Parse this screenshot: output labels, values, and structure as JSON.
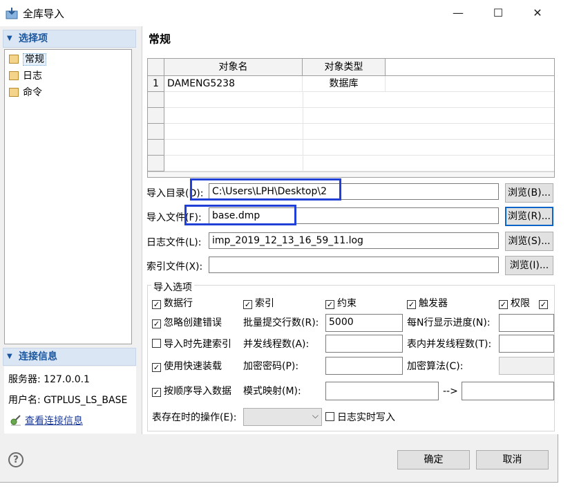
{
  "window": {
    "title": "全库导入",
    "minimize_glyph": "—",
    "maximize_glyph": "☐",
    "close_glyph": "✕"
  },
  "left": {
    "options_header": "选择项",
    "tree_items": [
      "常规",
      "日志",
      "命令"
    ],
    "connection_header": "连接信息",
    "server": "服务器: 127.0.0.1",
    "user": "用户名: GTPLUS_LS_BASE",
    "view_link": "查看连接信息"
  },
  "main": {
    "section_title": "常规",
    "grid": {
      "columns": [
        "对象名",
        "对象类型"
      ],
      "rows": [
        {
          "num": "1",
          "name": "DAMENG5238",
          "type": "数据库"
        }
      ]
    },
    "import_dir": {
      "label": "导入目录(D):",
      "value": "C:\\Users\\LPH\\Desktop\\2",
      "browse": "浏览(B)..."
    },
    "import_file": {
      "label": "导入文件(F):",
      "value": "base.dmp",
      "browse": "浏览(R)..."
    },
    "log_file": {
      "label": "日志文件(L):",
      "value": "imp_2019_12_13_16_59_11.log",
      "browse": "浏览(S)..."
    },
    "index_file": {
      "label": "索引文件(X):",
      "value": "",
      "browse": "浏览(I)..."
    },
    "options": {
      "title": "导入选项",
      "rows": "数据行",
      "index": "索引",
      "constraint": "约束",
      "trigger": "触发器",
      "privilege": "权限",
      "ignore_errors": "忽略创建错误",
      "batch_rows_label": "批量提交行数(R):",
      "batch_rows_value": "5000",
      "progress_label": "每N行显示进度(N):",
      "create_index_first": "导入时先建索引",
      "threads_label": "并发线程数(A):",
      "table_threads_label": "表内并发线程数(T):",
      "fast_load": "使用快速装载",
      "encrypt_pwd_label": "加密密码(P):",
      "encrypt_algo_label": "加密算法(C):",
      "ordered_import": "按顺序导入数据",
      "schema_map_label": "模式映射(M):",
      "schema_arrow": "-->",
      "table_exists_label": "表存在时的操作(E):",
      "log_realtime": "日志实时写入"
    }
  },
  "footer": {
    "ok": "确定",
    "cancel": "取消",
    "help_glyph": "?"
  },
  "colors": {
    "highlight_box": "#1f3fd6",
    "section_header_bg": "#dbe6f4",
    "link": "#1a3a99"
  }
}
